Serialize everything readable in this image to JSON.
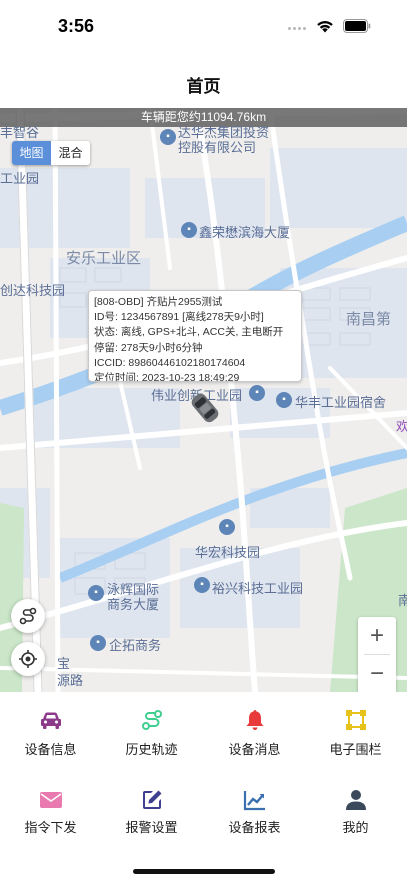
{
  "status_bar": {
    "time": "3:56"
  },
  "header": {
    "title": "首页"
  },
  "map": {
    "distance_text": "车辆距您约11094.76km",
    "map_types": {
      "standard": "地图",
      "hybrid": "混合"
    },
    "poi_labels": {
      "p1": "丰智谷",
      "p2": "达华杰集团投资",
      "p3": "控股有限公司",
      "p4": "工业园",
      "p5": "鑫荣懋滨海大厦",
      "p6": "安乐工业区",
      "p7": "创达科技园",
      "p8": "南昌第",
      "p9": "伟业创新工业园",
      "p10": "华丰工业园宿舍",
      "p11": "欢",
      "p12": "华宏科技园",
      "p13": "泳辉国际",
      "p14": "商务大厦",
      "p15": "裕兴科技工业园",
      "p16": "企拓商务",
      "p17": "宝",
      "p18": "源路",
      "p19": "南"
    },
    "info_popup": {
      "line1": "[808-OBD] 齐贴片2955测试",
      "line2": "ID号: 1234567891 [离线278天9小时]",
      "line3": "状态: 离线, GPS+北斗, ACC关, 主电断开",
      "line4": "停留: 278天9小时6分钟",
      "line5": "ICCID: 89860446102180174604",
      "line6": "定位时间: 2023-10-23 18:49:29"
    },
    "zoom": {
      "in_label": "+",
      "out_label": "−"
    }
  },
  "menu": {
    "items": [
      {
        "label": "设备信息",
        "icon": "car-icon",
        "color": "#8e3a8a"
      },
      {
        "label": "历史轨迹",
        "icon": "route-icon",
        "color": "#3ecf8e"
      },
      {
        "label": "设备消息",
        "icon": "bell-icon",
        "color": "#e83a3a"
      },
      {
        "label": "电子围栏",
        "icon": "fence-icon",
        "color": "#e6c21b"
      },
      {
        "label": "指令下发",
        "icon": "mail-icon",
        "color": "#e87ab0"
      },
      {
        "label": "报警设置",
        "icon": "edit-icon",
        "color": "#3f3f8f"
      },
      {
        "label": "设备报表",
        "icon": "chart-icon",
        "color": "#3a6fb0"
      },
      {
        "label": "我的",
        "icon": "user-icon",
        "color": "#3a4a5c"
      }
    ]
  }
}
